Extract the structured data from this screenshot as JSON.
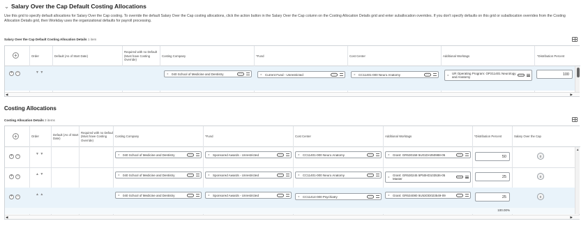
{
  "section_title": "Salary Over the Cap Default Costing Allocations",
  "intro": "Use this grid to specify default allocations for Salary Over the Cap costing. To override the default Salary Over the Cap costing allocations, click the action button in the Salary Over the Cap column on the Costing Allocation Details grid and enter suballocation overrides. If you don't specify defaults on this grid or suballocation overrides from the Costing Allocation Details grid, then Workday uses the organizational defaults for payroll processing.",
  "grid1": {
    "label": "Salary Over the Cap Default Costing Allocation Details",
    "count": "1 item",
    "headers": [
      "Order",
      "Default (As of Start Date)",
      "Required with no Default (Must have Costing Override)",
      "Costing Company",
      "*Fund",
      "Cost Center",
      "Additional Worktags",
      "*Distribution Percent"
    ],
    "row": {
      "company": "040 School of Medicine and Dentistry",
      "fund": "Current Fund - Unrestricted",
      "cost_center": "CC11401-000 Neuro Anatomy",
      "worktags": "UR Operating Program: OP211401 Neurology and Anatomy",
      "percent": "100"
    }
  },
  "costing_title": "Costing Allocations",
  "grid2": {
    "label": "Costing Allocation Details",
    "count": "3 items",
    "headers": [
      "Order",
      "Default (As of Start Date)",
      "Required with no Default (Must have Costing Override)",
      "Costing Company",
      "*Fund",
      "Cost Center",
      "Additional Worktags",
      "*Distribution Percent",
      "Salary Over the Cap"
    ],
    "rows": [
      {
        "company": "040 School of Medicine and Dentistry",
        "fund": "Sponsored Awards - Unrestricted",
        "cost_center": "CC11401-000 Neuro Anatomy",
        "worktags": "Grant: GR530158 5U01DA050988-05",
        "percent": "50",
        "soc": "0"
      },
      {
        "company": "040 School of Medicine and Dentistry",
        "fund": "Sponsored Awards - Unrestricted",
        "cost_center": "CC11401-000 Neuro Anatomy",
        "worktags": "Grant: GR530245 5P50HD103536-05 Master",
        "percent": "25",
        "soc": "0"
      },
      {
        "company": "040 School of Medicine and Dentistry",
        "fund": "Sponsored Awards - Unrestricted",
        "cost_center": "CC11414-000 Psychiatry",
        "worktags": "Grant: GR534080 5U53OD023549-09",
        "percent": "25",
        "soc": "0"
      }
    ],
    "total": "100.00%"
  },
  "icons": {
    "expand": "chevron-down-icon",
    "grid_settings": "grid-icon",
    "add": "plus-icon",
    "remove": "minus-icon",
    "list": "list-icon",
    "more": "more-icon"
  }
}
